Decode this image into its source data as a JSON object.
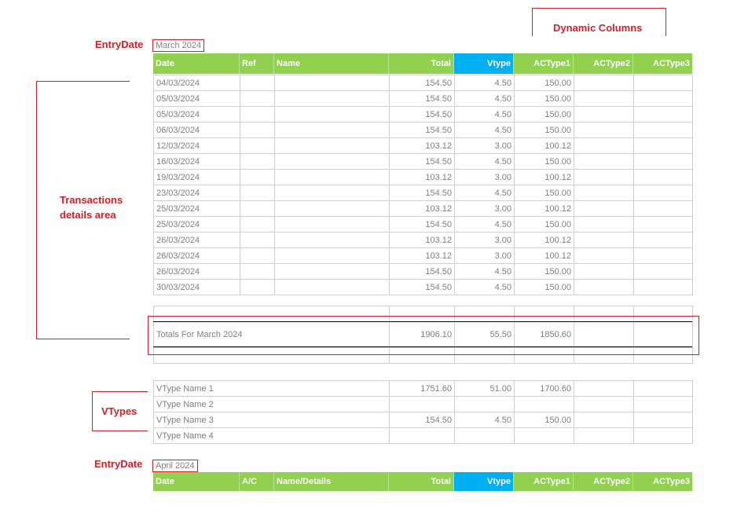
{
  "labels": {
    "dynamic_columns": "Dynamic Columns",
    "entry_date": "EntryDate",
    "transactions_line1": "Transactions",
    "transactions_line2": "details area",
    "vtypes": "VTypes"
  },
  "march": {
    "month": "March 2024",
    "headers": [
      "Date",
      "Ref",
      "Name",
      "Total",
      "Vtype",
      "ACType1",
      "ACType2",
      "ACType3"
    ],
    "rows": [
      [
        "04/03/2024",
        "",
        "",
        "154.50",
        "4.50",
        "150.00",
        "",
        ""
      ],
      [
        "05/03/2024",
        "",
        "",
        "154.50",
        "4.50",
        "150.00",
        "",
        ""
      ],
      [
        "05/03/2024",
        "",
        "",
        "154.50",
        "4.50",
        "150.00",
        "",
        ""
      ],
      [
        "06/03/2024",
        "",
        "",
        "154.50",
        "4.50",
        "150.00",
        "",
        ""
      ],
      [
        "12/03/2024",
        "",
        "",
        "103.12",
        "3.00",
        "100.12",
        "",
        ""
      ],
      [
        "16/03/2024",
        "",
        "",
        "154.50",
        "4.50",
        "150.00",
        "",
        ""
      ],
      [
        "19/03/2024",
        "",
        "",
        "103.12",
        "3.00",
        "100.12",
        "",
        ""
      ],
      [
        "23/03/2024",
        "",
        "",
        "154.50",
        "4.50",
        "150.00",
        "",
        ""
      ],
      [
        "25/03/2024",
        "",
        "",
        "103.12",
        "3.00",
        "100.12",
        "",
        ""
      ],
      [
        "25/03/2024",
        "",
        "",
        "154.50",
        "4.50",
        "150.00",
        "",
        ""
      ],
      [
        "26/03/2024",
        "",
        "",
        "103.12",
        "3.00",
        "100.12",
        "",
        ""
      ],
      [
        "26/03/2024",
        "",
        "",
        "103.12",
        "3.00",
        "100.12",
        "",
        ""
      ],
      [
        "26/03/2024",
        "",
        "",
        "154.50",
        "4.50",
        "150.00",
        "",
        ""
      ],
      [
        "30/03/2024",
        "",
        "",
        "154.50",
        "4.50",
        "150.00",
        "",
        ""
      ]
    ],
    "totals": [
      "Totals For March 2024",
      "1906.10",
      "55.50",
      "1850.60",
      "",
      ""
    ],
    "vtypes": [
      [
        "VType Name 1",
        "1751.60",
        "51.00",
        "1700.60",
        "",
        ""
      ],
      [
        "VType Name 2",
        "",
        "",
        "",
        "",
        ""
      ],
      [
        "VType Name 3",
        "154.50",
        "4.50",
        "150.00",
        "",
        ""
      ],
      [
        "VType Name 4",
        "",
        "",
        "",
        "",
        ""
      ]
    ]
  },
  "april": {
    "month": "April 2024",
    "headers": [
      "Date",
      "A/C",
      "Name/Details",
      "Total",
      "Vtype",
      "ACType1",
      "ACType2",
      "ACType3"
    ]
  }
}
